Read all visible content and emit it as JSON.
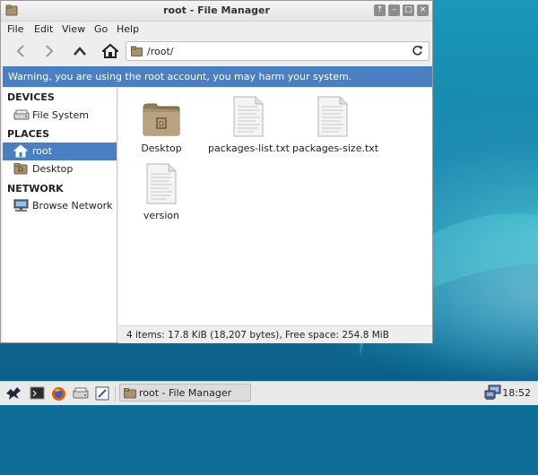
{
  "window": {
    "title": "root - File Manager",
    "controls": [
      "↑",
      "–",
      "□",
      "×"
    ]
  },
  "menu": [
    "File",
    "Edit",
    "View",
    "Go",
    "Help"
  ],
  "address": {
    "path": "/root/"
  },
  "warning": "Warning, you are using the root account, you may harm your system.",
  "sidebar": {
    "devices_heading": "DEVICES",
    "places_heading": "PLACES",
    "network_heading": "NETWORK",
    "items": [
      {
        "label": "File System",
        "icon": "drive-icon"
      },
      {
        "label": "root",
        "icon": "home-icon",
        "active": true
      },
      {
        "label": "Desktop",
        "icon": "folder-icon"
      },
      {
        "label": "Browse Network",
        "icon": "network-icon"
      }
    ]
  },
  "files": [
    {
      "name": "Desktop",
      "icon": "folder-icon"
    },
    {
      "name": "packages-list.txt",
      "icon": "text-file-icon"
    },
    {
      "name": "packages-size.txt",
      "icon": "text-file-icon"
    },
    {
      "name": "version",
      "icon": "text-file-icon"
    }
  ],
  "status": "4 items: 17.8 KiB (18,207 bytes), Free space: 254.8 MiB",
  "taskbar": {
    "task_label": "root - File Manager",
    "clock": "18:52"
  },
  "colors": {
    "accent": "#4a80c3",
    "folder": "#a89270",
    "desktop": "#1380a8"
  }
}
